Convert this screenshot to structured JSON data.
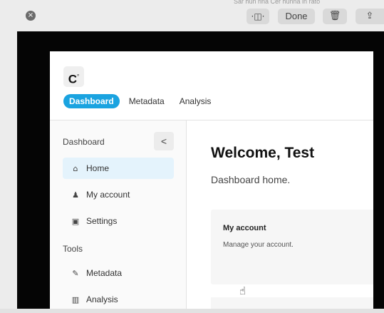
{
  "toolbar": {
    "close_icon": "×",
    "resize_icon": "·◫·",
    "done_label": "Done",
    "trash_icon": "🗑",
    "share_icon": "⇪",
    "clipped_text": "Sar hun rina Cer hunna in rato"
  },
  "app": {
    "logo": "C",
    "logo_mark": "°",
    "tabs": [
      {
        "label": "Dashboard",
        "active": true
      },
      {
        "label": "Metadata",
        "active": false
      },
      {
        "label": "Analysis",
        "active": false
      }
    ],
    "sidebar": {
      "section_dashboard": "Dashboard",
      "collapse_icon": "<",
      "items": [
        {
          "label": "Home",
          "icon": "⌂",
          "active": true
        },
        {
          "label": "My account",
          "icon": "♟",
          "active": false
        },
        {
          "label": "Settings",
          "icon": "▣",
          "active": false
        }
      ],
      "section_tools": "Tools",
      "tools": [
        {
          "label": "Metadata",
          "icon": "✎"
        },
        {
          "label": "Analysis",
          "icon": "▥"
        }
      ]
    },
    "main": {
      "title": "Welcome, Test",
      "subtitle": "Dashboard home.",
      "card": {
        "title": "My account",
        "description": "Manage your account."
      }
    }
  },
  "cursor_icon": "☝"
}
